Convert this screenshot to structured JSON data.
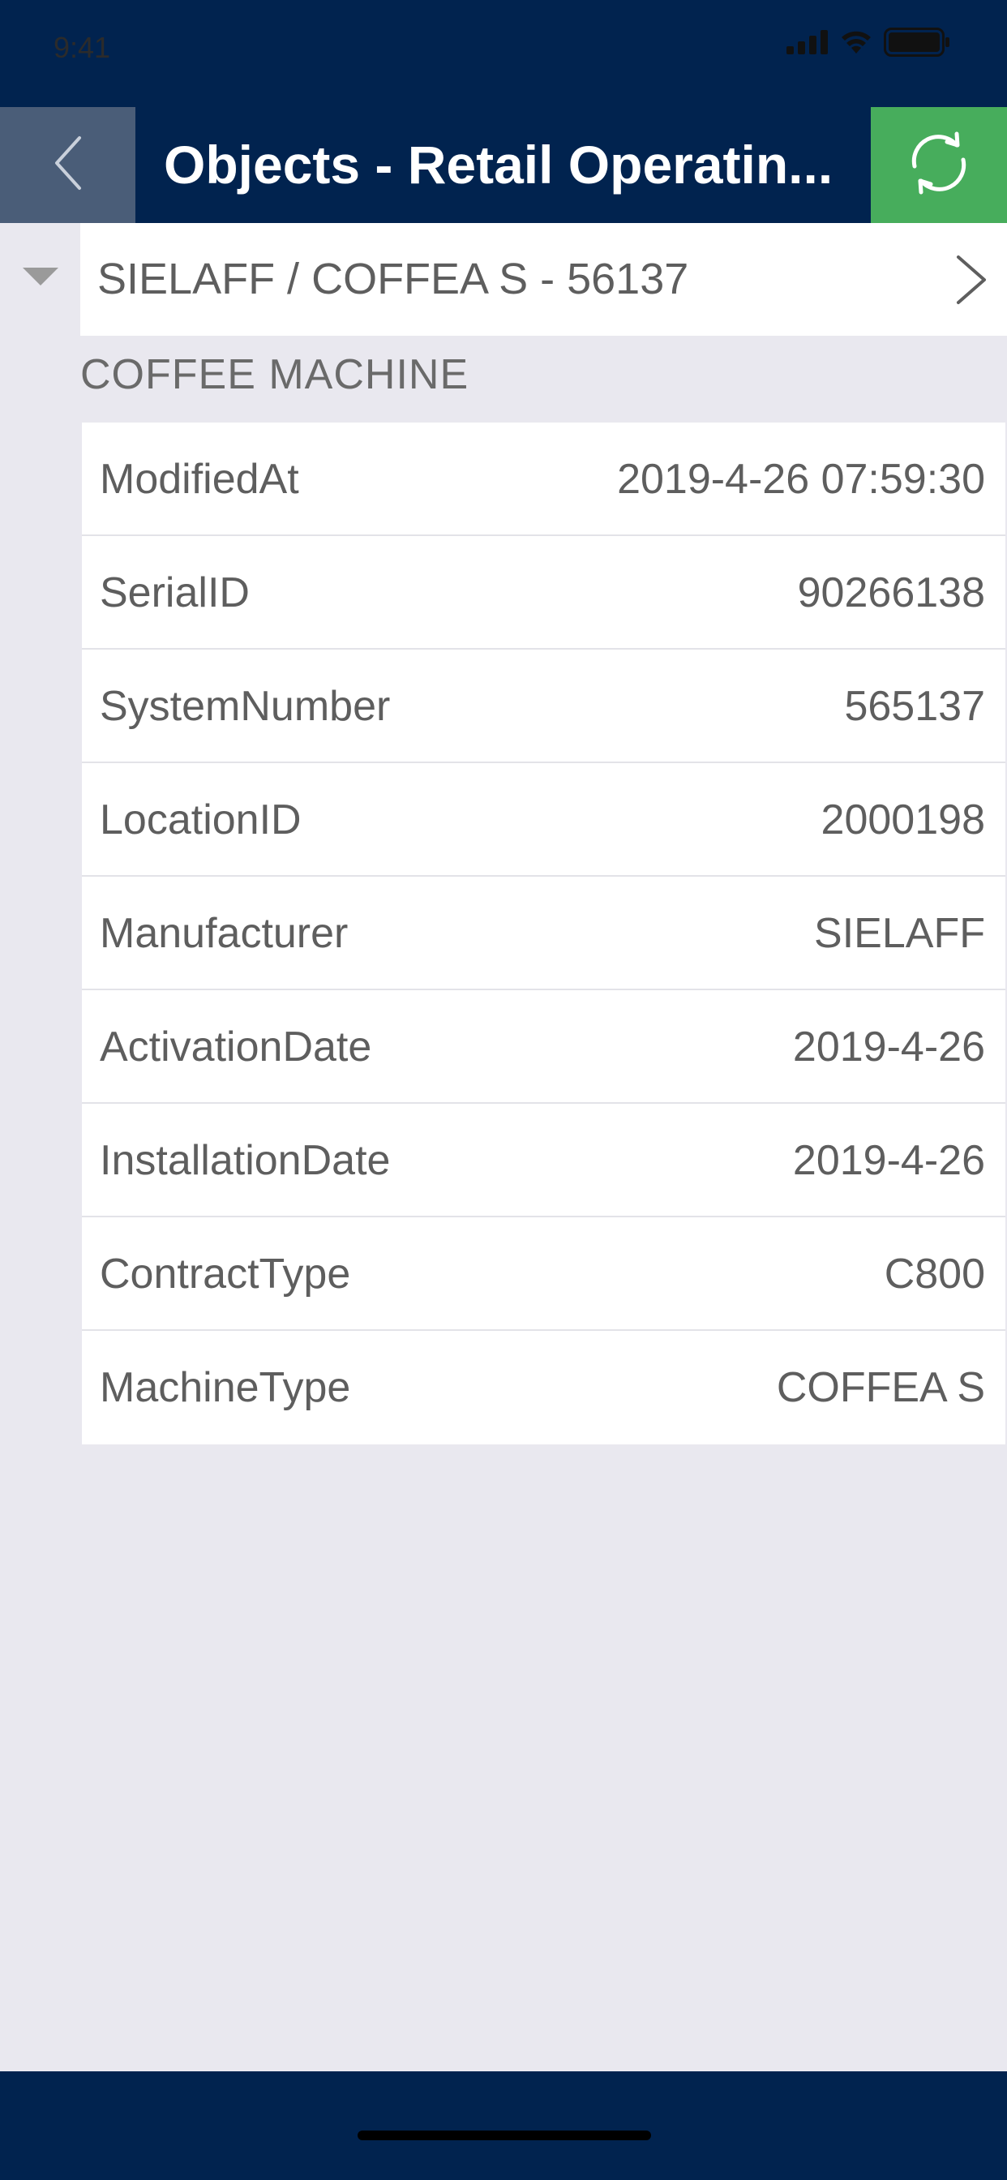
{
  "status_bar": {
    "time": "9:41",
    "icons": [
      "signal-icon",
      "wifi-icon",
      "battery-icon"
    ]
  },
  "nav": {
    "title": "Objects - Retail Operatin...",
    "back_icon": "chevron-left-icon",
    "refresh_icon": "refresh-icon",
    "colors": {
      "bar": "#01234f",
      "back": "#4a5d78",
      "refresh": "#47ad5c"
    }
  },
  "object": {
    "title": "SIELAFF / COFFEA S - 56137",
    "expanded": true
  },
  "section": {
    "title": "COFFEE MACHINE"
  },
  "properties": [
    {
      "label": "ModifiedAt",
      "value": "2019-4-26 07:59:30"
    },
    {
      "label": "SerialID",
      "value": "90266138"
    },
    {
      "label": "SystemNumber",
      "value": "565137"
    },
    {
      "label": "LocationID",
      "value": "2000198"
    },
    {
      "label": "Manufacturer",
      "value": "SIELAFF"
    },
    {
      "label": "ActivationDate",
      "value": "2019-4-26"
    },
    {
      "label": "InstallationDate",
      "value": "2019-4-26"
    },
    {
      "label": "ContractType",
      "value": "C800"
    },
    {
      "label": "MachineType",
      "value": "COFFEA S"
    }
  ]
}
